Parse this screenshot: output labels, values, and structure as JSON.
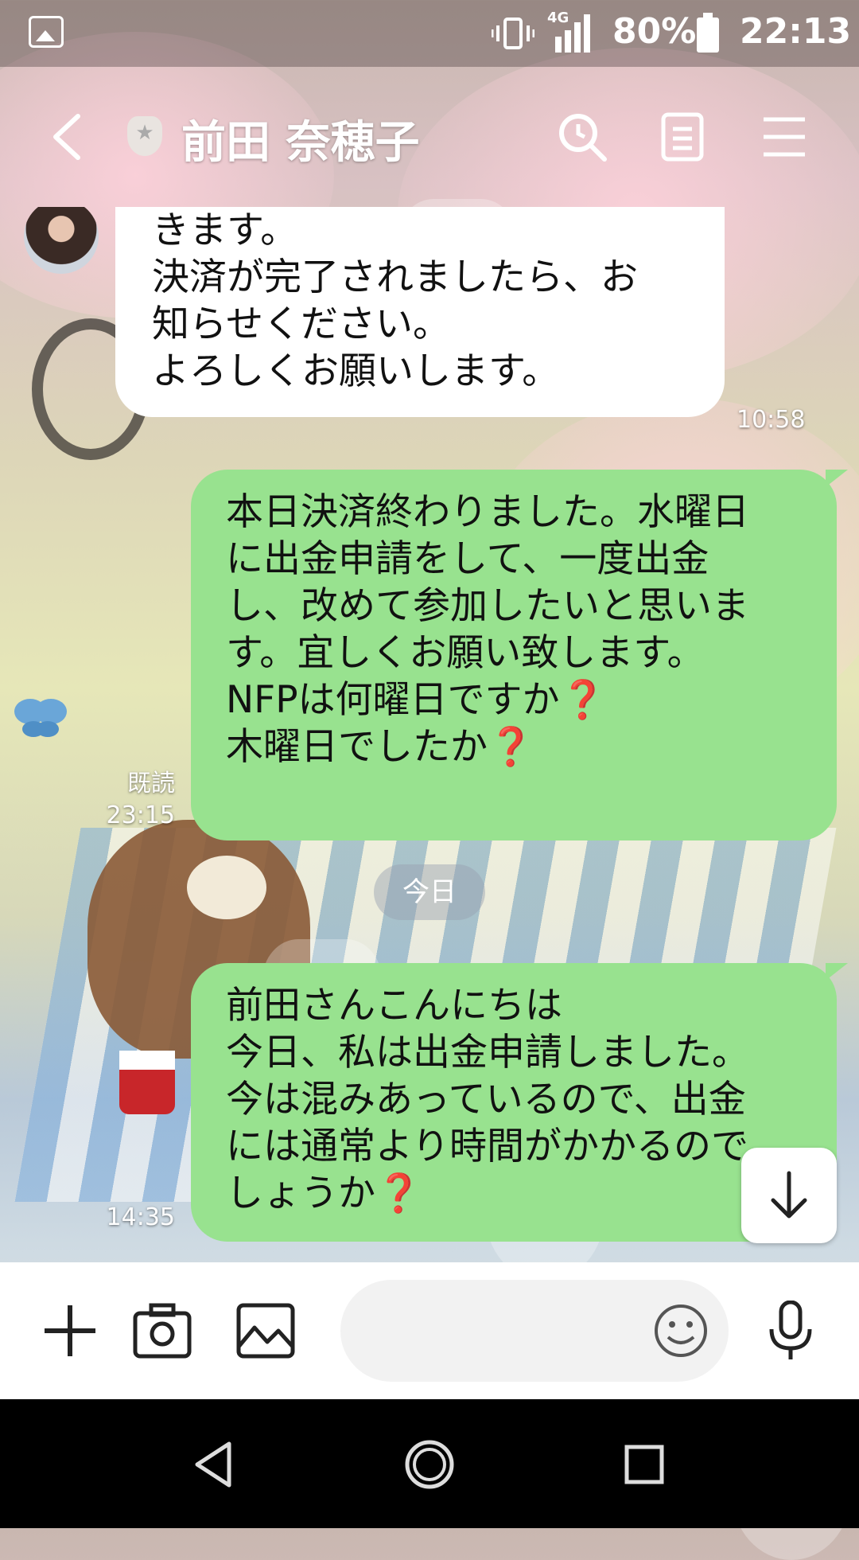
{
  "status_bar": {
    "network": "4G",
    "battery_percent": "80%",
    "time": "22:13"
  },
  "header": {
    "contact_name": "前田 奈穂子",
    "badge_icon": "star-shield-icon"
  },
  "messages": [
    {
      "direction": "incoming",
      "text": "きます。\n決済が完了されましたら、お\n知らせください。\nよろしくお願いします。",
      "time": "10:58"
    },
    {
      "direction": "outgoing",
      "text": "本日決済終わりました。水曜日\nに出金申請をして、一度出金\nし、改めて参加したいと思いま\nす。宜しくお願い致します。\nNFPは何曜日ですか❓\n木曜日でしたか❓",
      "read_label": "既読",
      "time": "23:15"
    },
    {
      "direction": "outgoing",
      "text": "前田さんこんにちは\n今日、私は出金申請しました。\n今は混みあっているので、出金\nには通常より時間がかかるので\nしょうか❓",
      "time": "14:35"
    }
  ],
  "date_separator": "今日",
  "input_bar": {
    "placeholder": ""
  },
  "colors": {
    "outgoing_bubble": "#98e28f",
    "incoming_bubble": "#ffffff"
  }
}
